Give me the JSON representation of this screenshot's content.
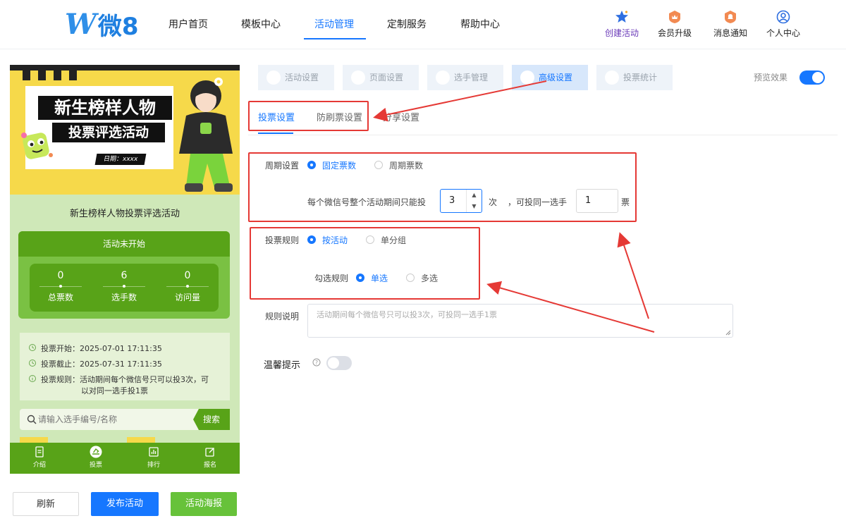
{
  "logo": {
    "mark": "W",
    "text": "微8"
  },
  "nav": {
    "items": [
      {
        "label": "用户首页"
      },
      {
        "label": "模板中心"
      },
      {
        "label": "活动管理"
      },
      {
        "label": "定制服务"
      },
      {
        "label": "帮助中心"
      }
    ],
    "active": "活动管理"
  },
  "top_tools": [
    {
      "label": "创建活动",
      "icon": "star-icon"
    },
    {
      "label": "会员升级",
      "icon": "crown-badge-icon"
    },
    {
      "label": "消息通知",
      "icon": "bell-badge-icon"
    },
    {
      "label": "个人中心",
      "icon": "user-circle-icon"
    }
  ],
  "preview": {
    "banner_line1": "新生榜样人物",
    "banner_line2": "投票评选活动",
    "banner_date": "日期：xxxx",
    "activity_name": "新生榜样人物投票评选活动",
    "status": "活动未开始",
    "stats": [
      {
        "value": "0",
        "label": "总票数"
      },
      {
        "value": "6",
        "label": "选手数"
      },
      {
        "value": "0",
        "label": "访问量"
      }
    ],
    "info": {
      "start": "投票开始：2025-07-01 17:11:35",
      "end": "投票截止：2025-07-31 17:11:35",
      "rule_line1": "投票规则：活动期间每个微信号只可以投3次，可",
      "rule_line2": "以对同一选手投1票"
    },
    "search_placeholder": "请输入选手编号/名称",
    "search_button": "搜索",
    "bottom_nav": [
      {
        "label": "介绍",
        "icon": "doc-icon"
      },
      {
        "label": "投票",
        "icon": "vote-icon"
      },
      {
        "label": "排行",
        "icon": "chart-icon"
      },
      {
        "label": "报名",
        "icon": "edit-icon"
      }
    ]
  },
  "actions": {
    "refresh": "刷新",
    "publish": "发布活动",
    "poster": "活动海报"
  },
  "steps": [
    {
      "label": "活动设置",
      "icon": "heart-icon"
    },
    {
      "label": "页面设置",
      "icon": "page-icon"
    },
    {
      "label": "选手管理",
      "icon": "user-icon"
    },
    {
      "label": "高级设置",
      "icon": "sliders-icon"
    },
    {
      "label": "投票统计",
      "icon": "stats-icon"
    }
  ],
  "active_step": "高级设置",
  "preview_toggle": {
    "label": "预览效果",
    "on": true
  },
  "subtabs": [
    {
      "label": "投票设置"
    },
    {
      "label": "防刷票设置"
    },
    {
      "label": "分享设置"
    }
  ],
  "active_subtab": "投票设置",
  "cycle": {
    "label": "周期设置",
    "options": [
      "固定票数",
      "周期票数"
    ],
    "selected": "固定票数",
    "prefix": "每个微信号整个活动期间只能投",
    "times_value": "3",
    "times_unit": "次",
    "mid": "，可投同一选手",
    "per_value": "1",
    "per_unit": "票"
  },
  "vote_rule": {
    "label": "投票规则",
    "options": [
      "按活动",
      "单分组"
    ],
    "selected": "按活动",
    "check_label": "勾选规则",
    "check_options": [
      "单选",
      "多选"
    ],
    "check_selected": "单选"
  },
  "rule_desc": {
    "label": "规则说明",
    "placeholder": "活动期间每个微信号只可以投3次，可投同一选手1票"
  },
  "tip": {
    "label": "温馨提示",
    "on": false
  },
  "colors": {
    "primary": "#1677ff",
    "green": "#58a318",
    "annotation": "#e53935",
    "banner": "#f6d94a"
  }
}
